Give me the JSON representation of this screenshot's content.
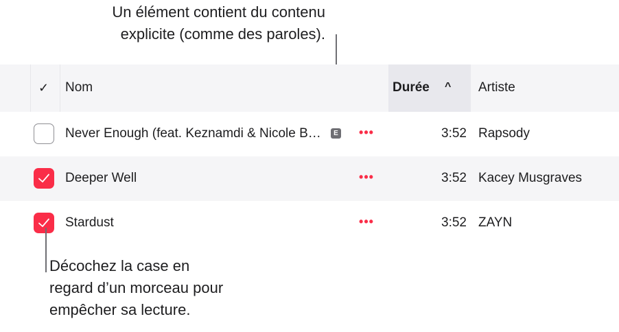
{
  "annotations": {
    "explicit_lines": [
      "Un élément contient du contenu",
      "explicite (comme des paroles)."
    ],
    "uncheck_lines": [
      "Décochez la case en",
      "regard d’un morceau pour",
      "empêcher sa lecture."
    ]
  },
  "header": {
    "check_symbol": "✓",
    "name": "Nom",
    "duration": "Durée",
    "sort_indicator": "^",
    "artist": "Artiste"
  },
  "tracks": [
    {
      "checked": false,
      "name": "Never Enough (feat. Keznamdi & Nicole Bus)",
      "explicit": true,
      "explicit_badge": "E",
      "more": "•••",
      "duration": "3:52",
      "artist": "Rapsody"
    },
    {
      "checked": true,
      "name": "Deeper Well",
      "explicit": false,
      "more": "•••",
      "duration": "3:52",
      "artist": "Kacey Musgraves"
    },
    {
      "checked": true,
      "name": "Stardust",
      "explicit": false,
      "more": "•••",
      "duration": "3:52",
      "artist": "ZAYN"
    }
  ],
  "colors": {
    "accent": "#fa2d48",
    "alt_row": "#f5f5f7",
    "sorted_header": "#e8e8ed",
    "badge": "#6e6e73"
  },
  "icons": {
    "checkmark": "checkmark-icon",
    "more": "more-ellipsis-icon",
    "sort": "sort-ascending-icon",
    "explicit": "explicit-icon"
  }
}
